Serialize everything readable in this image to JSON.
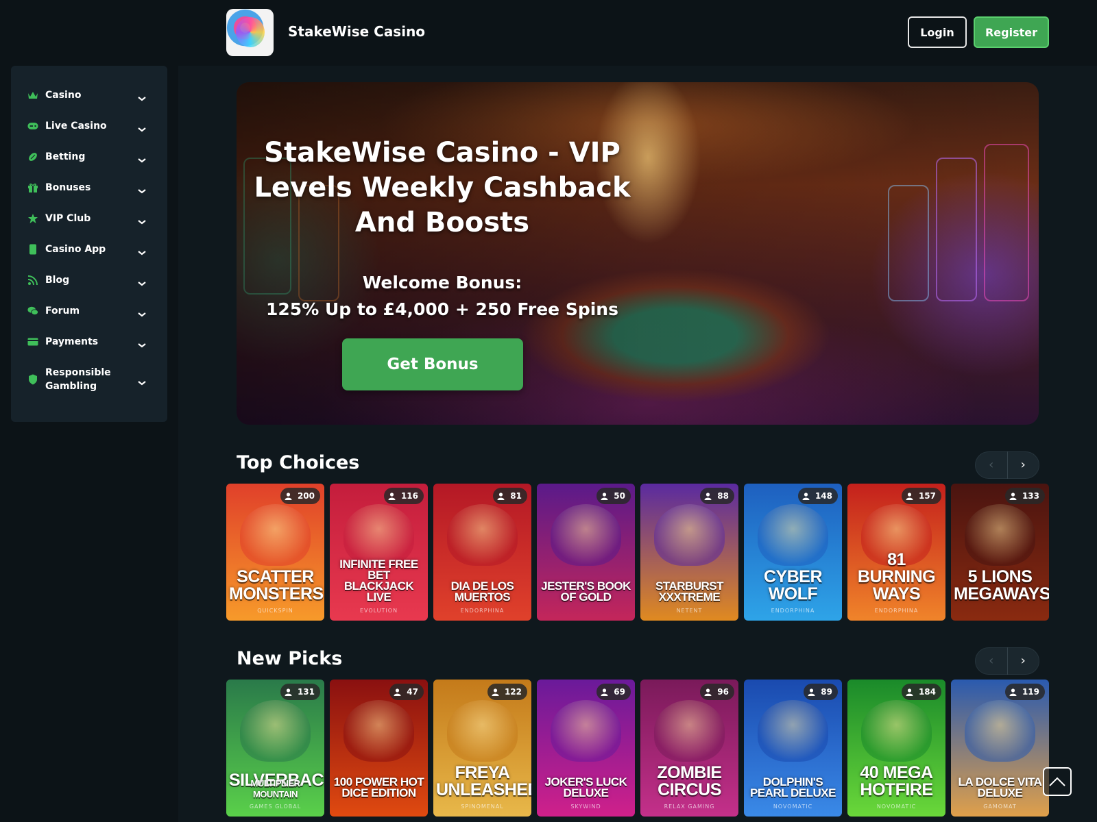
{
  "header": {
    "brand": "StakeWise Casino",
    "login_label": "Login",
    "register_label": "Register"
  },
  "sidebar": {
    "items": [
      {
        "label": "Casino",
        "icon": "crown-icon"
      },
      {
        "label": "Live Casino",
        "icon": "gamepad-icon"
      },
      {
        "label": "Betting",
        "icon": "football-icon"
      },
      {
        "label": "Bonuses",
        "icon": "gift-icon"
      },
      {
        "label": "VIP Club",
        "icon": "star-icon"
      },
      {
        "label": "Casino App",
        "icon": "mobile-icon"
      },
      {
        "label": "Blog",
        "icon": "rss-icon"
      },
      {
        "label": "Forum",
        "icon": "comments-icon"
      },
      {
        "label": "Payments",
        "icon": "credit-card-icon"
      },
      {
        "label": "Responsible Gambling",
        "icon": "shield-icon"
      }
    ]
  },
  "hero": {
    "title": "StakeWise Casino - VIP Levels Weekly Cashback And Boosts",
    "bonus_line1": "Welcome Bonus:",
    "bonus_line2": "125% Up to £4,000 + 250 Free Spins",
    "cta_label": "Get Bonus"
  },
  "top_choices": {
    "title": "Top Choices",
    "prev": "‹",
    "next": "›",
    "games": [
      {
        "name": "SCATTER MONSTERS",
        "provider": "QUICKSPIN",
        "players": "200",
        "colors": [
          "#e0402a",
          "#f79a2a"
        ]
      },
      {
        "name": "INFINITE FREE BET BLACKJACK LIVE",
        "provider": "EVOLUTION",
        "players": "116",
        "colors": [
          "#c41d3c",
          "#e8394f"
        ]
      },
      {
        "name": "DIA DE LOS MUERTOS",
        "provider": "ENDORPHINA",
        "players": "81",
        "colors": [
          "#b41826",
          "#e0412b"
        ]
      },
      {
        "name": "JESTER'S BOOK OF GOLD",
        "provider": "",
        "players": "50",
        "colors": [
          "#5a1a8a",
          "#c4265a"
        ]
      },
      {
        "name": "STARBURST XXXTREME",
        "provider": "NETENT",
        "players": "88",
        "colors": [
          "#5a2aa0",
          "#e08a20"
        ]
      },
      {
        "name": "CYBER WOLF",
        "provider": "ENDORPHINA",
        "players": "148",
        "colors": [
          "#1e5fbf",
          "#2ea4e8"
        ]
      },
      {
        "name": "81 BURNING WAYS",
        "provider": "ENDORPHINA",
        "players": "157",
        "colors": [
          "#c4201c",
          "#f0842a"
        ]
      },
      {
        "name": "5 LIONS MEGAWAYS",
        "provider": "",
        "players": "133",
        "colors": [
          "#4a1410",
          "#8a2a10"
        ]
      }
    ]
  },
  "new_picks": {
    "title": "New Picks",
    "prev": "‹",
    "next": "›",
    "games": [
      {
        "name": "SILVERBACK",
        "subname": "MULTIPLIER MOUNTAIN",
        "provider": "GAMES GLOBAL",
        "players": "131",
        "colors": [
          "#2a7a4a",
          "#5ad04a"
        ]
      },
      {
        "name": "100 POWER HOT DICE EDITION",
        "provider": "",
        "players": "47",
        "colors": [
          "#8a1010",
          "#e04a10"
        ]
      },
      {
        "name": "FREYA UNLEASHED",
        "provider": "SPINOMENAL",
        "players": "122",
        "colors": [
          "#c47a1a",
          "#e8b84a"
        ]
      },
      {
        "name": "JOKER'S LUCK DELUXE",
        "provider": "SKYWIND",
        "players": "69",
        "colors": [
          "#6a1a9a",
          "#d0208a"
        ]
      },
      {
        "name": "ZOMBIE CIRCUS",
        "provider": "RELAX GAMING",
        "players": "96",
        "colors": [
          "#7a1a5a",
          "#c4308a"
        ]
      },
      {
        "name": "DOLPHIN'S PEARL DELUXE",
        "provider": "NOVOMATIC",
        "players": "89",
        "colors": [
          "#1a4aaf",
          "#3a8ae8"
        ]
      },
      {
        "name": "40 MEGA HOTFIRE",
        "provider": "NOVOMATIC",
        "players": "184",
        "colors": [
          "#1a8a2a",
          "#6ad83a"
        ]
      },
      {
        "name": "LA DOLCE VITA DELUXE",
        "provider": "GAMOMAT",
        "players": "119",
        "colors": [
          "#2a5aaf",
          "#e0a04a"
        ]
      }
    ]
  },
  "colors": {
    "accent_green": "#3fa653",
    "icon_green": "#3fbf5a",
    "background": "#0f181d",
    "sidebar_panel": "#16222a"
  }
}
